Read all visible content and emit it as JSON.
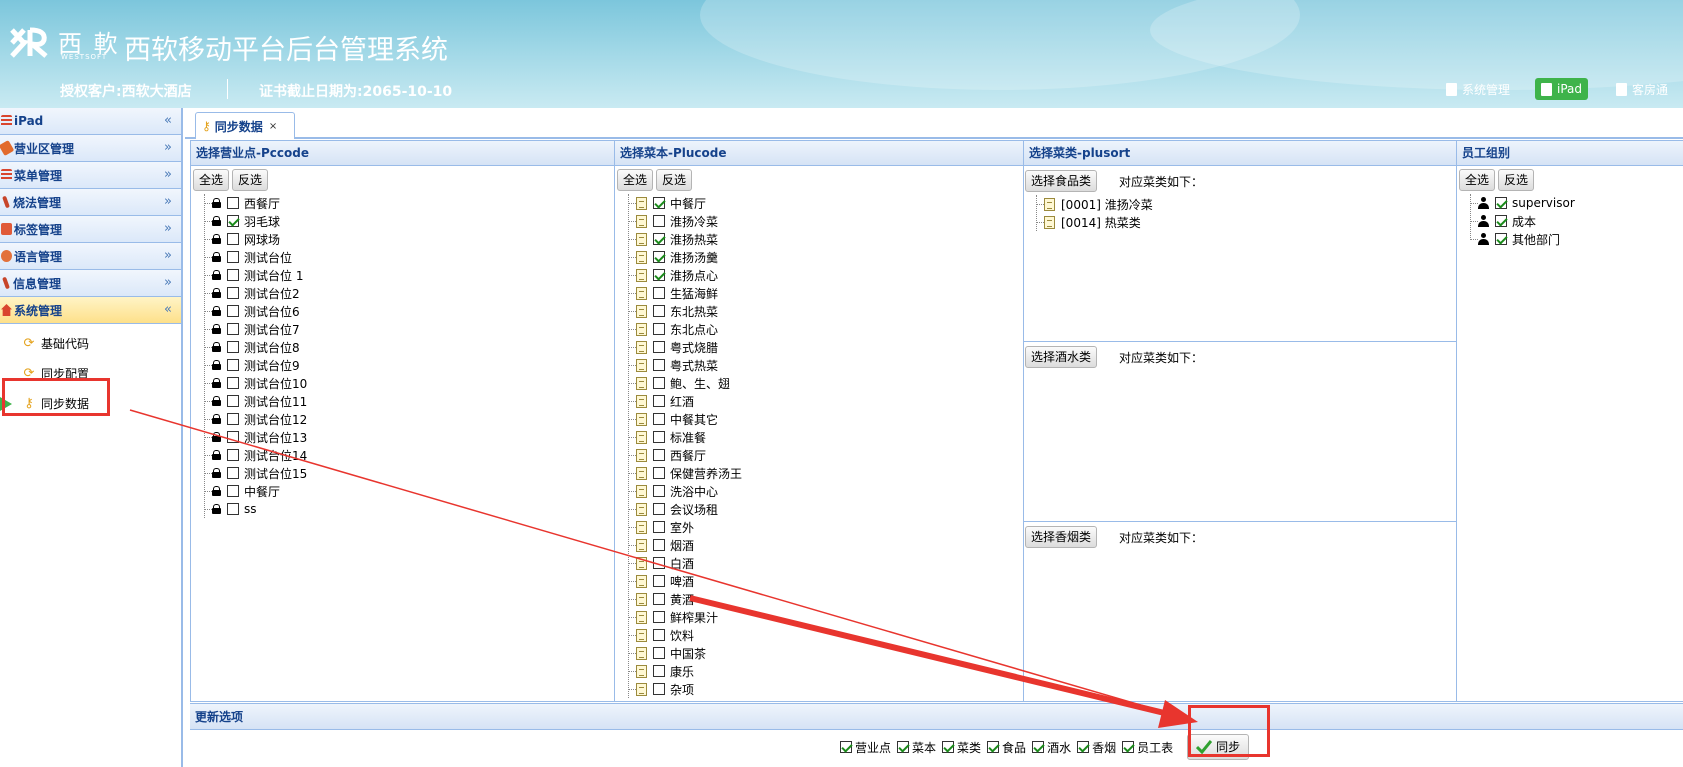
{
  "header": {
    "logo_cn": "西 軟",
    "logo_en": "WESTSOFT",
    "system_title": "西软移动平台后台管理系统",
    "customer": "授权客户:西软大酒店",
    "cert_expiry": "证书截止日期为:2065-10-10",
    "nav": [
      {
        "label": "系统管理",
        "icon": "document-icon"
      },
      {
        "label": "iPad",
        "icon": "ipad-icon"
      },
      {
        "label": "客房通",
        "icon": "document-icon"
      }
    ]
  },
  "sidebar": {
    "items": [
      {
        "label": "iPad",
        "icon": "menu-lines-icon",
        "chevron": "«",
        "color": "#d9452e"
      },
      {
        "label": "营业区管理",
        "icon": "tag-icon",
        "chevron": "»",
        "color": "#e26a2c"
      },
      {
        "label": "菜单管理",
        "icon": "menu-lines-icon",
        "chevron": "»",
        "color": "#d9452e"
      },
      {
        "label": "烧法管理",
        "icon": "wrench-icon",
        "chevron": "»",
        "color": "#c7452a"
      },
      {
        "label": "标签管理",
        "icon": "tag-icon",
        "chevron": "»",
        "color": "#e05a38"
      },
      {
        "label": "语言管理",
        "icon": "globe-icon",
        "chevron": "»",
        "color": "#e2703a"
      },
      {
        "label": "信息管理",
        "icon": "wrench-icon",
        "chevron": "»",
        "color": "#c7452a"
      },
      {
        "label": "系统管理",
        "icon": "home-icon",
        "chevron": "«",
        "color": "#d9452e"
      }
    ],
    "sub_items": [
      {
        "label": "基础代码",
        "icon": "sync-icon"
      },
      {
        "label": "同步配置",
        "icon": "sync-icon"
      },
      {
        "label": "同步数据",
        "icon": "key-icon"
      }
    ]
  },
  "tab": {
    "label": "同步数据",
    "close": "×"
  },
  "pccode_panel": {
    "title": "选择营业点-Pccode",
    "select_all": "全选",
    "invert": "反选",
    "items": [
      {
        "label": "西餐厅",
        "checked": false
      },
      {
        "label": "羽毛球",
        "checked": true
      },
      {
        "label": "网球场",
        "checked": false
      },
      {
        "label": "测试台位",
        "checked": false
      },
      {
        "label": "测试台位 1",
        "checked": false
      },
      {
        "label": "测试台位2",
        "checked": false
      },
      {
        "label": "测试台位6",
        "checked": false
      },
      {
        "label": "测试台位7",
        "checked": false
      },
      {
        "label": "测试台位8",
        "checked": false
      },
      {
        "label": "测试台位9",
        "checked": false
      },
      {
        "label": "测试台位10",
        "checked": false
      },
      {
        "label": "测试台位11",
        "checked": false
      },
      {
        "label": "测试台位12",
        "checked": false
      },
      {
        "label": "测试台位13",
        "checked": false
      },
      {
        "label": "测试台位14",
        "checked": false
      },
      {
        "label": "测试台位15",
        "checked": false
      },
      {
        "label": "中餐厅",
        "checked": false
      },
      {
        "label": "ss",
        "checked": false
      }
    ]
  },
  "plucode_panel": {
    "title": "选择菜本-Plucode",
    "select_all": "全选",
    "invert": "反选",
    "items": [
      {
        "label": "中餐厅",
        "checked": true
      },
      {
        "label": "淮扬冷菜",
        "checked": false
      },
      {
        "label": "淮扬热菜",
        "checked": true
      },
      {
        "label": "淮扬汤羹",
        "checked": true
      },
      {
        "label": "淮扬点心",
        "checked": true
      },
      {
        "label": "生猛海鲜",
        "checked": false
      },
      {
        "label": "东北热菜",
        "checked": false
      },
      {
        "label": "东北点心",
        "checked": false
      },
      {
        "label": "粤式烧腊",
        "checked": false
      },
      {
        "label": "粤式热菜",
        "checked": false
      },
      {
        "label": "鲍、生、翅",
        "checked": false
      },
      {
        "label": "红酒",
        "checked": false
      },
      {
        "label": "中餐其它",
        "checked": false
      },
      {
        "label": "标准餐",
        "checked": false
      },
      {
        "label": "西餐厅",
        "checked": false
      },
      {
        "label": "保健营养汤王",
        "checked": false
      },
      {
        "label": "洗浴中心",
        "checked": false
      },
      {
        "label": "会议场租",
        "checked": false
      },
      {
        "label": "室外",
        "checked": false
      },
      {
        "label": "烟酒",
        "checked": false
      },
      {
        "label": "白酒",
        "checked": false
      },
      {
        "label": "啤酒",
        "checked": false
      },
      {
        "label": "黄酒",
        "checked": false
      },
      {
        "label": "鲜榨果汁",
        "checked": false
      },
      {
        "label": "饮料",
        "checked": false
      },
      {
        "label": "中国茶",
        "checked": false
      },
      {
        "label": "康乐",
        "checked": false
      },
      {
        "label": "杂项",
        "checked": false
      }
    ]
  },
  "plusort_panel": {
    "title": "选择菜类-plusort",
    "sections": [
      {
        "button": "选择食品类",
        "label": "对应菜类如下：",
        "items": [
          "[0001] 淮扬冷菜",
          "[0014] 热菜类"
        ]
      },
      {
        "button": "选择酒水类",
        "label": "对应菜类如下：",
        "items": []
      },
      {
        "button": "选择香烟类",
        "label": "对应菜类如下：",
        "items": []
      }
    ]
  },
  "staff_panel": {
    "title": "员工组别",
    "select_all": "全选",
    "invert": "反选",
    "items": [
      {
        "label": "supervisor",
        "checked": true
      },
      {
        "label": "成本",
        "checked": true
      },
      {
        "label": "其他部门",
        "checked": true
      }
    ]
  },
  "update_options": {
    "title": "更新选项",
    "options": [
      {
        "label": "营业点",
        "checked": true
      },
      {
        "label": "菜本",
        "checked": true
      },
      {
        "label": "菜类",
        "checked": true
      },
      {
        "label": "食品",
        "checked": true
      },
      {
        "label": "酒水",
        "checked": true
      },
      {
        "label": "香烟",
        "checked": true
      },
      {
        "label": "员工表",
        "checked": true
      }
    ],
    "sync_button": "同步"
  },
  "colors": {
    "accent": "#15428b",
    "border": "#99bbe8",
    "annotation": "#e8352e",
    "ipad_badge": "#3eb34a"
  }
}
